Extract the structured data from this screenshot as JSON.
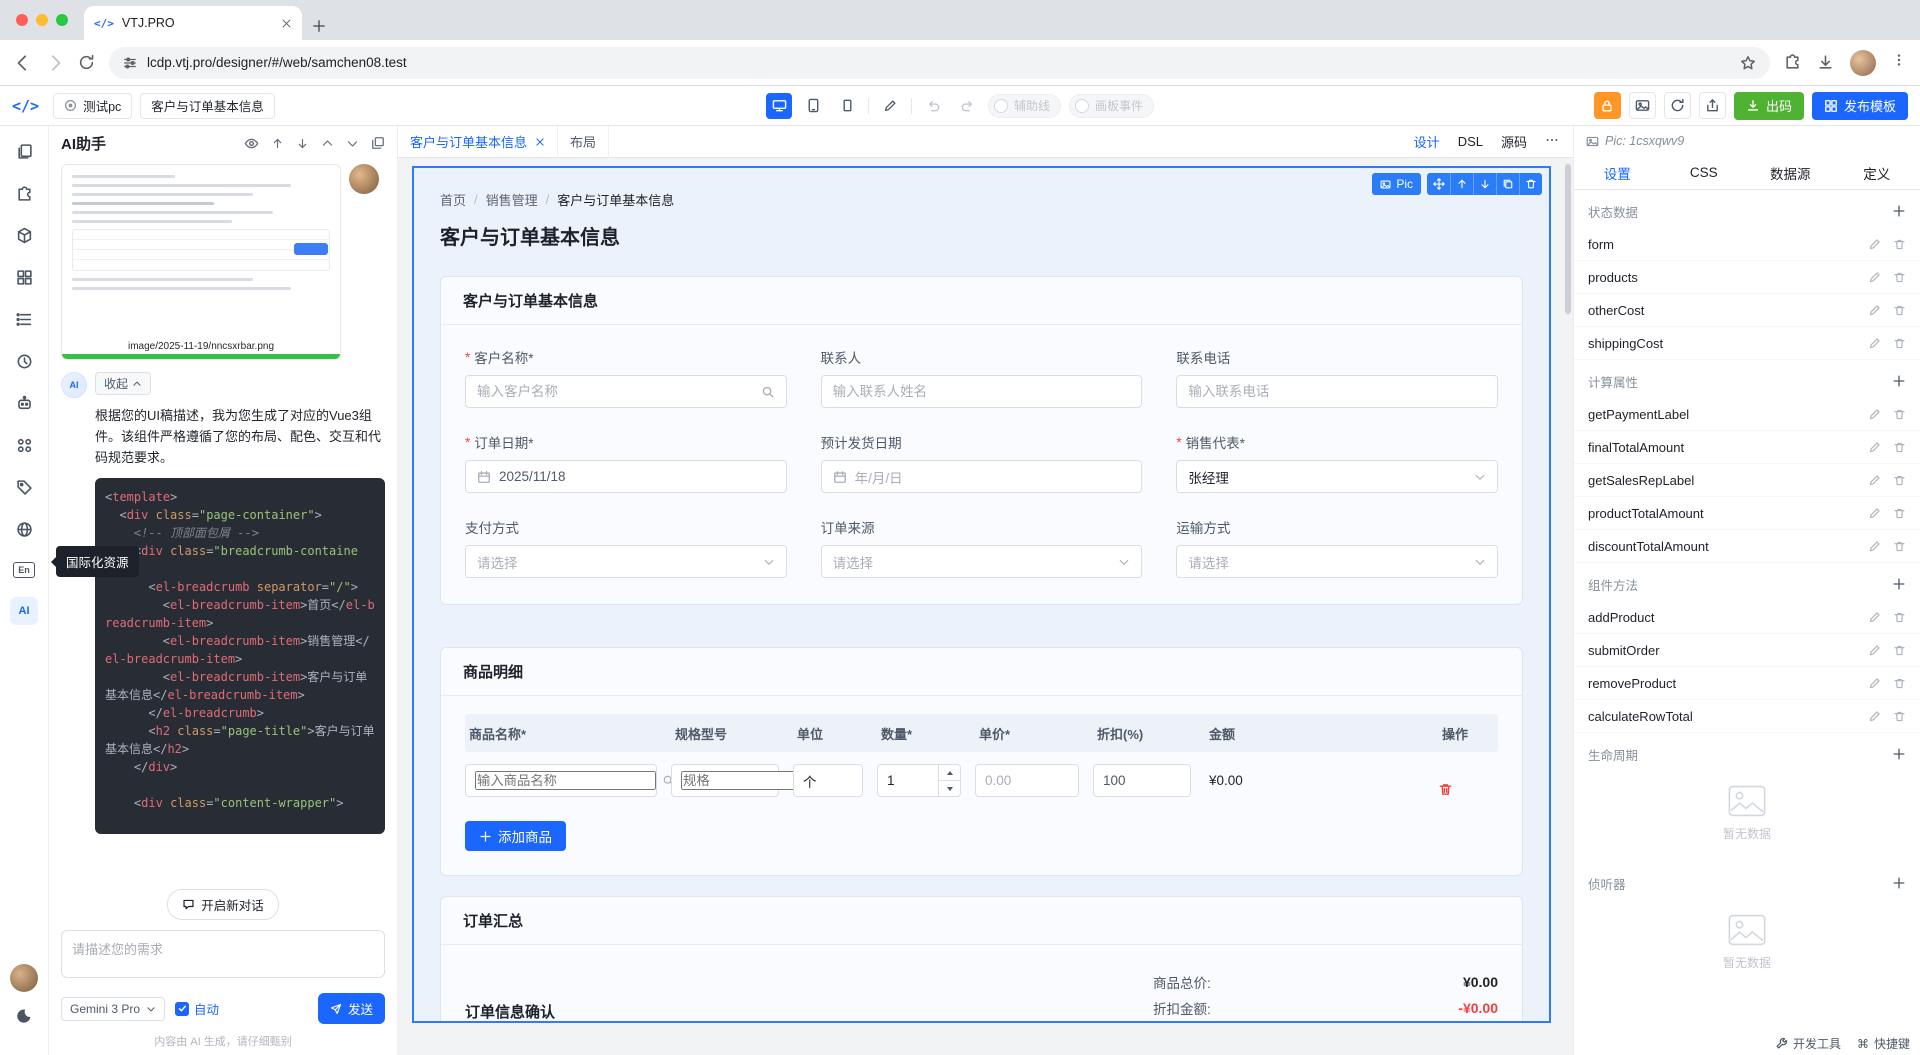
{
  "ui": {
    "required_mark": "*",
    "breadcrumb_separator": "/",
    "command_glyph": "⌘"
  },
  "browser": {
    "tab_title": "VTJ.PRO",
    "url": "lcdp.vtj.pro/designer/#/web/samchen08.test"
  },
  "toolbar": {
    "project_label": "测试pc",
    "page_label": "客户与订单基本信息",
    "guides_label": "辅助线",
    "events_label": "画板事件",
    "codegen_label": "出码",
    "publish_label": "发布模板"
  },
  "sidebar": {
    "i18n_glyph": "En",
    "ai_glyph": "AI",
    "tooltip": "国际化资源"
  },
  "ai_panel": {
    "title": "AI助手",
    "attachment_name": "image/2025-11-19/nncsxrbar.png",
    "collapse_label": "收起",
    "message": "根据您的UI稿描述，我为您生成了对应的Vue3组件。该组件严格遵循了您的布局、配色、交互和代码规范要求。",
    "code_lines": [
      "<template>",
      "  <div class=\"page-container\">",
      "    <!-- 顶部面包屑 -->",
      "    <div class=\"breadcrumb-container\">",
      "      <el-breadcrumb separator=\"/\">",
      "        <el-breadcrumb-item>首页</el-breadcrumb-item>",
      "        <el-breadcrumb-item>销售管理</el-breadcrumb-item>",
      "        <el-breadcrumb-item>客户与订单基本信息</el-breadcrumb-item>",
      "      </el-breadcrumb>",
      "      <h2 class=\"page-title\">客户与订单基本信息</h2>",
      "    </div>",
      "",
      "    <div class=\"content-wrapper\">"
    ],
    "new_chat": "开启新对话",
    "input_placeholder": "请描述您的需求",
    "model": "Gemini 3 Pro",
    "auto_label": "自动",
    "send_label": "发送",
    "disclaimer": "内容由 AI 生成，请仔细甄别"
  },
  "canvas": {
    "tab_active": "客户与订单基本信息",
    "tab_layout": "布局",
    "mode_design": "设计",
    "mode_dsl": "DSL",
    "mode_source": "源码",
    "selection_badge": "Pic",
    "breadcrumb": [
      "首页",
      "销售管理",
      "客户与订单基本信息"
    ],
    "page_title": "客户与订单基本信息",
    "basic_card": {
      "title": "客户与订单基本信息",
      "fields": [
        {
          "label": "客户名称*",
          "placeholder": "输入客户名称"
        },
        {
          "label": "联系人",
          "placeholder": "输入联系人姓名"
        },
        {
          "label": "联系电话",
          "placeholder": "输入联系电话"
        },
        {
          "label": "订单日期*",
          "value": "2025/11/18"
        },
        {
          "label": "预计发货日期",
          "placeholder": "年/月/日"
        },
        {
          "label": "销售代表*",
          "value": "张经理"
        },
        {
          "label": "支付方式",
          "placeholder": "请选择"
        },
        {
          "label": "订单来源",
          "placeholder": "请选择"
        },
        {
          "label": "运输方式",
          "placeholder": "请选择"
        }
      ]
    },
    "detail_card": {
      "title": "商品明细",
      "columns": [
        "商品名称*",
        "规格型号",
        "单位",
        "数量*",
        "单价*",
        "折扣(%)",
        "金额",
        "操作"
      ],
      "row": {
        "name_placeholder": "输入商品名称",
        "spec_placeholder": "规格",
        "unit": "个",
        "qty": "1",
        "price": "0.00",
        "discount": "100",
        "amount": "¥0.00"
      },
      "add_label": "添加商品"
    },
    "summary_card": {
      "title": "订单汇总",
      "confirm_title": "订单信息确认",
      "total_label": "商品总价:",
      "total_value": "¥0.00",
      "discount_label": "折扣金额:",
      "discount_value": "-¥0.00"
    }
  },
  "right_panel": {
    "node_label": "Pic: 1csxqwv9",
    "tabs": [
      "设置",
      "CSS",
      "数据源",
      "定义"
    ],
    "sections": [
      {
        "title": "状态数据",
        "items": [
          "form",
          "products",
          "otherCost",
          "shippingCost"
        ]
      },
      {
        "title": "计算属性",
        "items": [
          "getPaymentLabel",
          "finalTotalAmount",
          "getSalesRepLabel",
          "productTotalAmount",
          "discountTotalAmount"
        ]
      },
      {
        "title": "组件方法",
        "items": [
          "addProduct",
          "submitOrder",
          "removeProduct",
          "calculateRowTotal"
        ]
      },
      {
        "title": "生命周期",
        "empty": "暂无数据"
      },
      {
        "title": "侦听器",
        "empty": "暂无数据"
      }
    ]
  },
  "statusbar": {
    "devtools": "开发工具",
    "shortcuts": "快捷键"
  }
}
